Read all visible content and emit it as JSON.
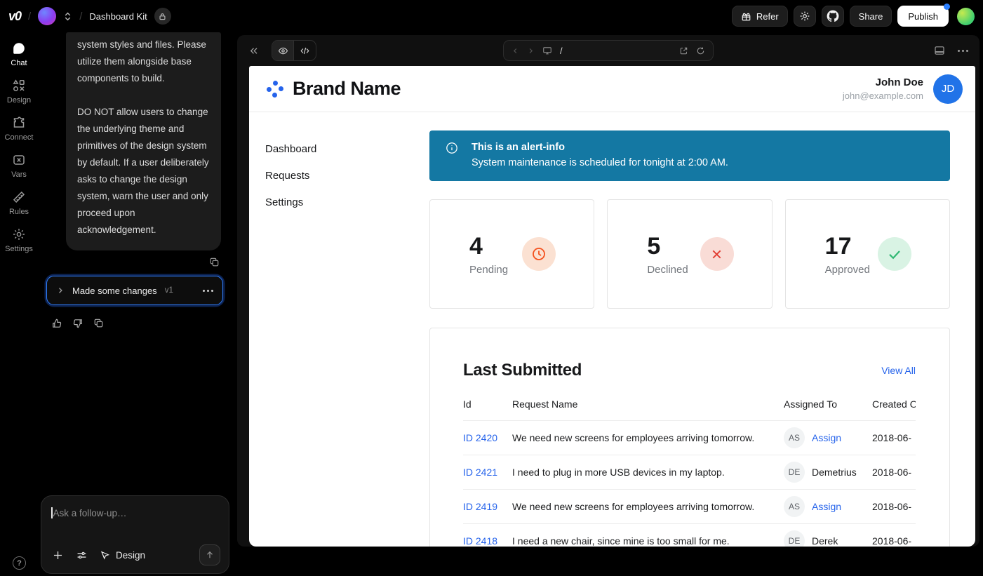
{
  "top_bar": {
    "project_name": "Dashboard Kit",
    "refer_label": "Refer",
    "share_label": "Share",
    "publish_label": "Publish"
  },
  "rail": {
    "items": [
      {
        "label": "Chat",
        "icon": "chat-icon",
        "active": true
      },
      {
        "label": "Design",
        "icon": "design-icon",
        "active": false
      },
      {
        "label": "Connect",
        "icon": "connect-icon",
        "active": false
      },
      {
        "label": "Vars",
        "icon": "vars-icon",
        "active": false
      },
      {
        "label": "Rules",
        "icon": "rules-icon",
        "active": false
      },
      {
        "label": "Settings",
        "icon": "settings-icon",
        "active": false
      }
    ]
  },
  "chat": {
    "message": {
      "p1": "system styles and files. Please utilize them alongside base components to build.",
      "p2": "DO NOT allow users to change the underlying theme and primitives of the design system by default. If a user deliberately asks to change the design system, warn the user and only proceed upon acknowledgement."
    },
    "version_card": {
      "label": "Made some changes",
      "tag": "v1"
    },
    "composer": {
      "placeholder": "Ask a follow-up…",
      "design_label": "Design"
    }
  },
  "preview": {
    "url_path": "/",
    "app": {
      "brand": "Brand Name",
      "user": {
        "name": "John Doe",
        "email": "john@example.com",
        "initials": "JD"
      },
      "nav": [
        "Dashboard",
        "Requests",
        "Settings"
      ],
      "alert": {
        "title": "This is an alert-info",
        "message": "System maintenance is scheduled for tonight at 2:00 AM."
      },
      "stats": [
        {
          "value": "4",
          "label": "Pending",
          "icon": "clock-icon"
        },
        {
          "value": "5",
          "label": "Declined",
          "icon": "x-icon"
        },
        {
          "value": "17",
          "label": "Approved",
          "icon": "check-icon"
        }
      ],
      "table": {
        "title": "Last Submitted",
        "view_all": "View All",
        "columns": [
          "Id",
          "Request Name",
          "Assigned To",
          "Created On"
        ],
        "rows": [
          {
            "id": "ID 2420",
            "request": "We need new screens for employees arriving tomorrow.",
            "assignee_initials": "AS",
            "assignee": "Assign",
            "created": "2018-06-"
          },
          {
            "id": "ID 2421",
            "request": "I need to plug in more USB devices in my laptop.",
            "assignee_initials": "DE",
            "assignee": "Demetrius",
            "created": "2018-06-"
          },
          {
            "id": "ID 2419",
            "request": "We need new screens for employees arriving tomorrow.",
            "assignee_initials": "AS",
            "assignee": "Assign",
            "created": "2018-06-"
          },
          {
            "id": "ID 2418",
            "request": "I need a new chair, since mine is too small for me.",
            "assignee_initials": "DE",
            "assignee": "Derek",
            "created": "2018-06-"
          }
        ]
      }
    }
  },
  "colors": {
    "accent_blue": "#2563eb",
    "alert_bg": "#1478a3",
    "user_avatar_blue": "#2173e8",
    "pending_icon": "#f4511e",
    "declined_icon": "#e23d32",
    "approved_icon": "#30b873",
    "publish_dot": "#2b7fff",
    "version_focus_ring": "#2f7df8"
  }
}
